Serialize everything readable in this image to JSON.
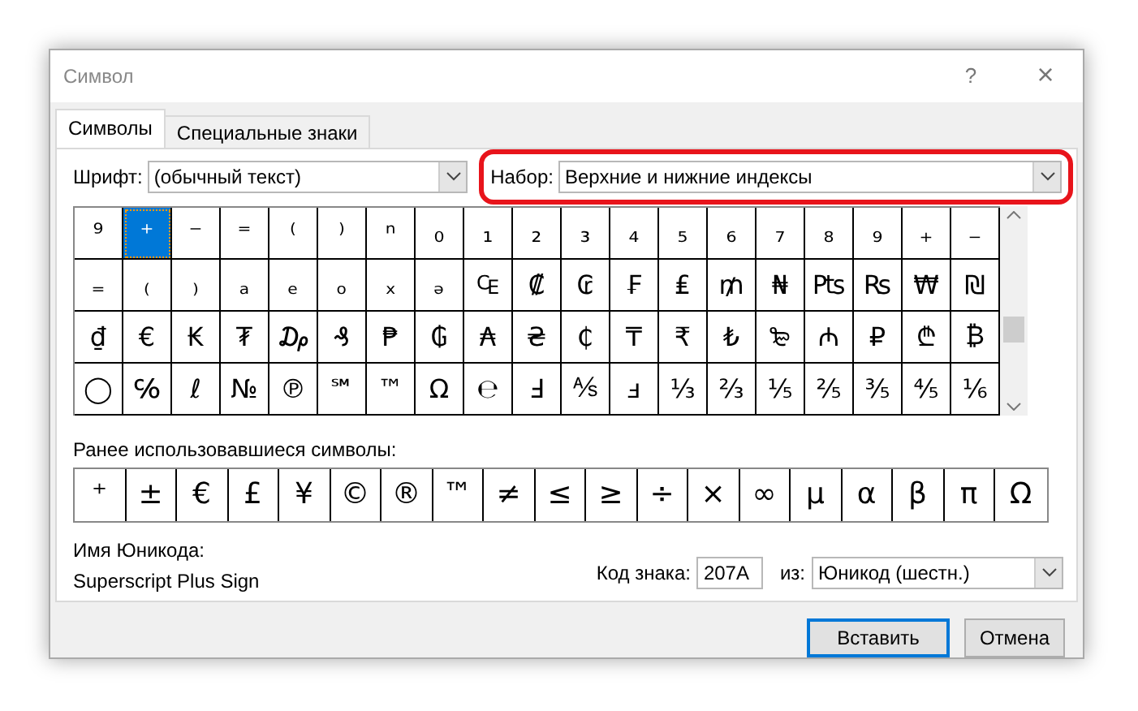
{
  "window": {
    "title": "Символ",
    "help": "?",
    "close": "×"
  },
  "tabs": [
    {
      "label": "Символы",
      "selected": true
    },
    {
      "label": "Специальные знаки",
      "selected": false
    }
  ],
  "font": {
    "label": "Шрифт:",
    "value": "(обычный текст)"
  },
  "subset": {
    "label": "Набор:",
    "value": "Верхние и нижние индексы",
    "highlighted": true
  },
  "grid": [
    [
      {
        "ch": "⁹",
        "selected": false
      },
      {
        "ch": "⁺",
        "selected": true
      },
      {
        "ch": "⁻",
        "selected": false
      },
      {
        "ch": "⁼",
        "selected": false
      },
      {
        "ch": "⁽",
        "selected": false
      },
      {
        "ch": "⁾",
        "selected": false
      },
      {
        "ch": "ⁿ",
        "selected": false
      },
      {
        "ch": "₀",
        "selected": false
      },
      {
        "ch": "₁",
        "selected": false
      },
      {
        "ch": "₂",
        "selected": false
      },
      {
        "ch": "₃",
        "selected": false
      },
      {
        "ch": "₄",
        "selected": false
      },
      {
        "ch": "₅",
        "selected": false
      },
      {
        "ch": "₆",
        "selected": false
      },
      {
        "ch": "₇",
        "selected": false
      },
      {
        "ch": "₈",
        "selected": false
      },
      {
        "ch": "₉",
        "selected": false
      },
      {
        "ch": "₊",
        "selected": false
      },
      {
        "ch": "₋",
        "selected": false
      }
    ],
    [
      {
        "ch": "₌",
        "selected": false
      },
      {
        "ch": "₍",
        "selected": false
      },
      {
        "ch": "₎",
        "selected": false
      },
      {
        "ch": "ₐ",
        "selected": false
      },
      {
        "ch": "ₑ",
        "selected": false
      },
      {
        "ch": "ₒ",
        "selected": false
      },
      {
        "ch": "ₓ",
        "selected": false
      },
      {
        "ch": "ₔ",
        "selected": false
      },
      {
        "ch": "₠",
        "selected": false
      },
      {
        "ch": "₡",
        "selected": false
      },
      {
        "ch": "₢",
        "selected": false
      },
      {
        "ch": "₣",
        "selected": false
      },
      {
        "ch": "₤",
        "selected": false
      },
      {
        "ch": "₥",
        "selected": false
      },
      {
        "ch": "₦",
        "selected": false
      },
      {
        "ch": "₧",
        "selected": false
      },
      {
        "ch": "₨",
        "selected": false
      },
      {
        "ch": "₩",
        "selected": false
      },
      {
        "ch": "₪",
        "selected": false
      }
    ],
    [
      {
        "ch": "₫",
        "selected": false
      },
      {
        "ch": "€",
        "selected": false
      },
      {
        "ch": "₭",
        "selected": false
      },
      {
        "ch": "₮",
        "selected": false
      },
      {
        "ch": "₯",
        "selected": false
      },
      {
        "ch": "₰",
        "selected": false
      },
      {
        "ch": "₱",
        "selected": false
      },
      {
        "ch": "₲",
        "selected": false
      },
      {
        "ch": "₳",
        "selected": false
      },
      {
        "ch": "₴",
        "selected": false
      },
      {
        "ch": "₵",
        "selected": false
      },
      {
        "ch": "₸",
        "selected": false
      },
      {
        "ch": "₹",
        "selected": false
      },
      {
        "ch": "₺",
        "selected": false
      },
      {
        "ch": "₻",
        "selected": false
      },
      {
        "ch": "₼",
        "selected": false
      },
      {
        "ch": "₽",
        "selected": false
      },
      {
        "ch": "₾",
        "selected": false
      },
      {
        "ch": "₿",
        "selected": false
      }
    ],
    [
      {
        "ch": "◯",
        "selected": false
      },
      {
        "ch": "℅",
        "selected": false
      },
      {
        "ch": "ℓ",
        "selected": false
      },
      {
        "ch": "№",
        "selected": false
      },
      {
        "ch": "℗",
        "selected": false
      },
      {
        "ch": "℠",
        "selected": false
      },
      {
        "ch": "™",
        "selected": false
      },
      {
        "ch": "Ω",
        "selected": false
      },
      {
        "ch": "℮",
        "selected": false
      },
      {
        "ch": "Ⅎ",
        "selected": false
      },
      {
        "ch": "⅍",
        "selected": false
      },
      {
        "ch": "ⅎ",
        "selected": false
      },
      {
        "ch": "⅓",
        "selected": false
      },
      {
        "ch": "⅔",
        "selected": false
      },
      {
        "ch": "⅕",
        "selected": false
      },
      {
        "ch": "⅖",
        "selected": false
      },
      {
        "ch": "⅗",
        "selected": false
      },
      {
        "ch": "⅘",
        "selected": false
      },
      {
        "ch": "⅙",
        "selected": false
      }
    ]
  ],
  "recent": {
    "label": "Ранее использовавшиеся символы:",
    "symbols": [
      "⁺",
      "±",
      "€",
      "£",
      "¥",
      "©",
      "®",
      "™",
      "≠",
      "≤",
      "≥",
      "÷",
      "×",
      "∞",
      "μ",
      "α",
      "β",
      "π",
      "Ω"
    ]
  },
  "unicode_name": {
    "label": "Имя Юникода:",
    "value": "Superscript Plus Sign"
  },
  "char_code": {
    "label": "Код знака:",
    "value": "207A"
  },
  "from": {
    "label": "из:",
    "value": "Юникод (шестн.)"
  },
  "buttons": [
    {
      "label": "Вставить",
      "default": true
    },
    {
      "label": "Отмена",
      "default": false
    }
  ]
}
